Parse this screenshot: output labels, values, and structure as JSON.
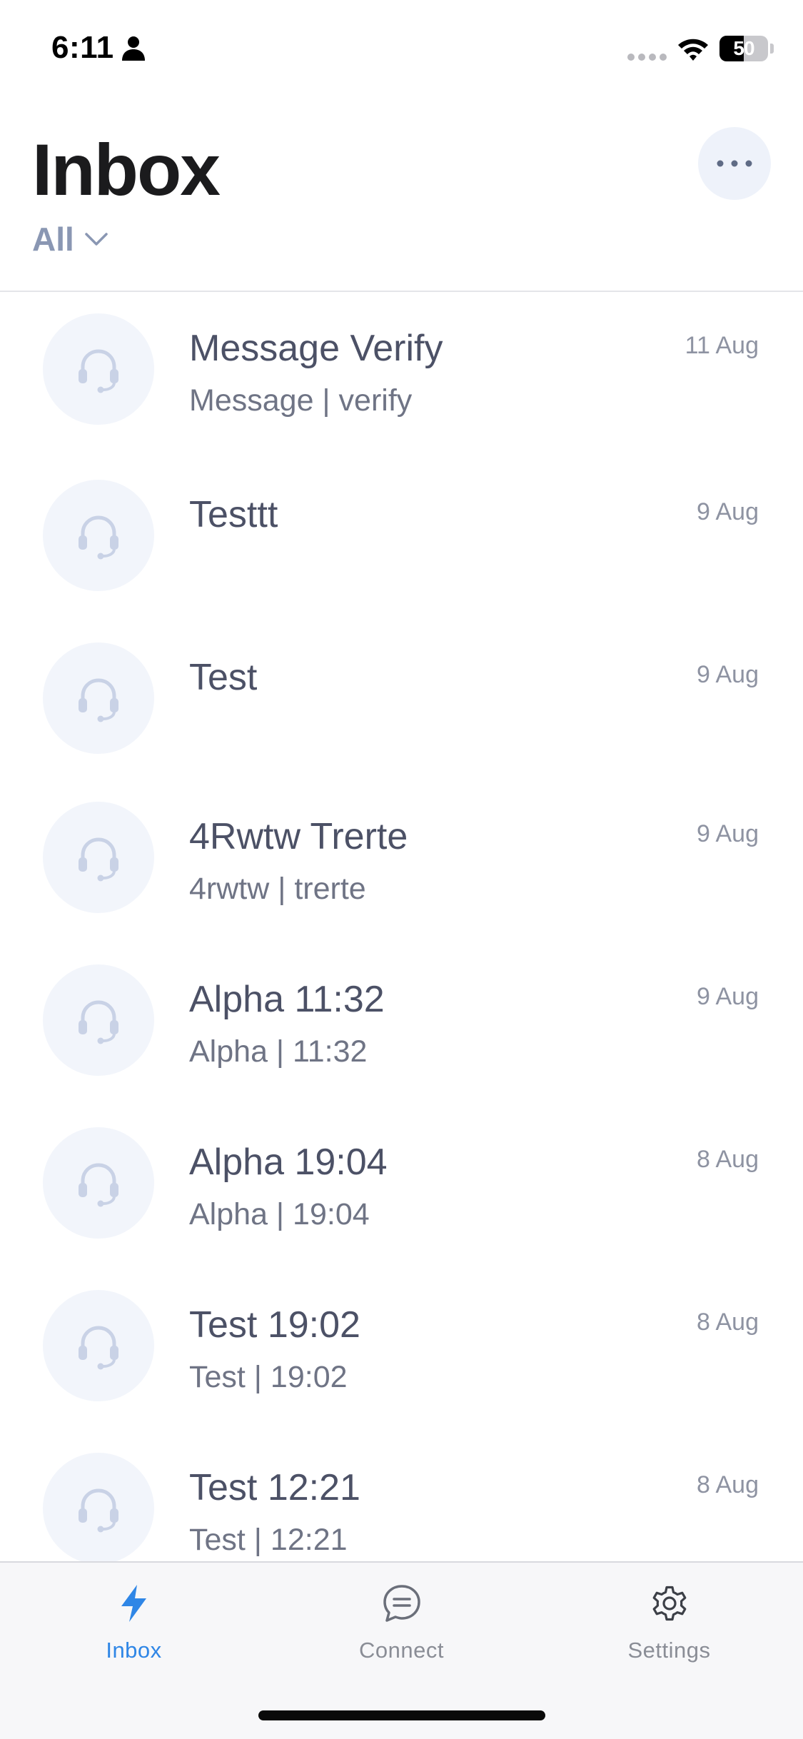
{
  "status_bar": {
    "time": "6:11",
    "battery_percent": 50,
    "battery_label": "50"
  },
  "header": {
    "title": "Inbox",
    "filter_label": "All",
    "filter_icon": "chevron-down-icon",
    "more_icon": "ellipsis-icon"
  },
  "conversations": [
    {
      "title": "Message Verify",
      "subtitle": "Message | verify",
      "date": "11 Aug",
      "avatar_icon": "headset-icon"
    },
    {
      "title": "Testtt",
      "subtitle": "",
      "date": "9 Aug",
      "avatar_icon": "headset-icon"
    },
    {
      "title": "Test",
      "subtitle": "",
      "date": "9 Aug",
      "avatar_icon": "headset-icon"
    },
    {
      "title": "4Rwtw Trerte",
      "subtitle": "4rwtw | trerte",
      "date": "9 Aug",
      "avatar_icon": "headset-icon"
    },
    {
      "title": "Alpha 11:32",
      "subtitle": "Alpha | 11:32",
      "date": "9 Aug",
      "avatar_icon": "headset-icon"
    },
    {
      "title": "Alpha 19:04",
      "subtitle": "Alpha | 19:04",
      "date": "8 Aug",
      "avatar_icon": "headset-icon"
    },
    {
      "title": "Test 19:02",
      "subtitle": "Test | 19:02",
      "date": "8 Aug",
      "avatar_icon": "headset-icon"
    },
    {
      "title": "Test 12:21",
      "subtitle": "Test | 12:21",
      "date": "8 Aug",
      "avatar_icon": "headset-icon"
    }
  ],
  "tab_bar": {
    "tabs": [
      {
        "label": "Inbox",
        "icon": "lightning-icon",
        "active": true
      },
      {
        "label": "Connect",
        "icon": "chat-bubble-icon",
        "active": false
      },
      {
        "label": "Settings",
        "icon": "gear-icon",
        "active": false
      }
    ]
  },
  "colors": {
    "accent": "#2f86e6",
    "avatar_bg": "#f2f5fb",
    "filter_text": "#8a97b3",
    "title_text": "#4c5166"
  }
}
